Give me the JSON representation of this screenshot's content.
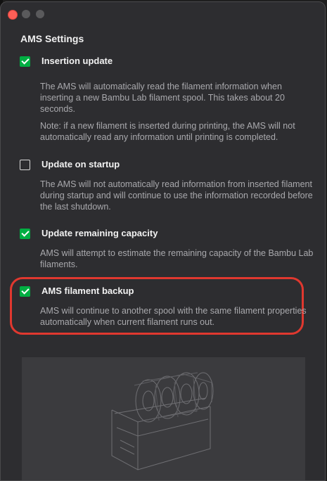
{
  "window": {
    "title": "AMS Settings"
  },
  "options": [
    {
      "title": "Insertion update",
      "checked": true,
      "descriptions": [
        "The AMS will automatically read the filament information when inserting a new Bambu Lab filament spool. This takes about 20 seconds.",
        "Note: if a new filament is inserted during  printing, the AMS will not automatically read any information until printing is completed."
      ]
    },
    {
      "title": "Update on startup",
      "checked": false,
      "descriptions": [
        "The AMS will not automatically read information from inserted filament during startup and will continue to use the information recorded before the last shutdown."
      ]
    },
    {
      "title": "Update remaining capacity",
      "checked": true,
      "descriptions": [
        "AMS will attempt to estimate the remaining capacity of the Bambu Lab filaments."
      ]
    },
    {
      "title": "AMS filament backup",
      "checked": true,
      "descriptions": [
        "AMS will continue to another spool with the same filament properties automatically when current filament runs out."
      ]
    }
  ],
  "colors": {
    "accent_green": "#00ae42",
    "highlight_red": "#e0382f"
  }
}
